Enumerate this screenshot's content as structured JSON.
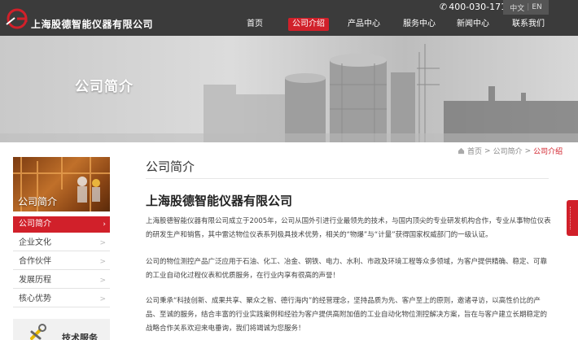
{
  "header": {
    "brand": "上海股德智能仪器有限公司",
    "phone": "400-030-1718",
    "lang": {
      "zh": "中文",
      "sep": "|",
      "en": "EN"
    },
    "nav": [
      {
        "label": "首页",
        "active": false
      },
      {
        "label": "公司介绍",
        "active": true
      },
      {
        "label": "产品中心",
        "active": false
      },
      {
        "label": "服务中心",
        "active": false
      },
      {
        "label": "新闻中心",
        "active": false
      },
      {
        "label": "联系我们",
        "active": false
      }
    ],
    "colors": {
      "bar": "#3b3b3b",
      "accent": "#d1202a"
    }
  },
  "banner": {
    "title": "公司简介"
  },
  "sidebar": {
    "hero_title": "公司简介",
    "items": [
      {
        "label": "公司简介",
        "active": true
      },
      {
        "label": "企业文化",
        "active": false
      },
      {
        "label": "合作伙伴",
        "active": false
      },
      {
        "label": "发展历程",
        "active": false
      },
      {
        "label": "核心优势",
        "active": false
      }
    ],
    "chev": ">",
    "active_chev": "›",
    "service_label": "技术服务"
  },
  "breadcrumb": {
    "home": "首页",
    "sep": ">",
    "parent": "公司简介",
    "current": "公司介绍"
  },
  "main": {
    "title": "公司简介",
    "company_name": "上海股德智能仪器有限公司",
    "paragraphs": [
      "上海股德智能仪器有限公司成立于2005年，公司从国外引进行业最领先的技术，与国内顶尖的专业研发机构合作，专业从事物位仪表的研发生产和销售，其中雷达物位仪表系列极具技术优势，相关的“物爆”与“计量”获得国家权威部门的一级认证。",
      "公司的物位测控产品广泛应用于石油、化工、冶金、钢铁、电力、水利、市政及环境工程等众多领域，为客户提供精确、稳定、可靠的工业自动化过程仪表和优质服务，在行业内享有很高的声誉！",
      "公司秉承“科技创新、成果共享、聚众之智、德行海内”的经营理念，坚持品质为先、客户至上的原则，邀诸寻访，以高性价比的产品、至诚的服务，结合丰富的行业实践案例和经验为客户提供高附加值的工业自动化物位测控解决方案，旨在与客户建立长期稳定的战略合作关系欢迎来电垂询，我们将竭诚为您服务！"
    ]
  }
}
